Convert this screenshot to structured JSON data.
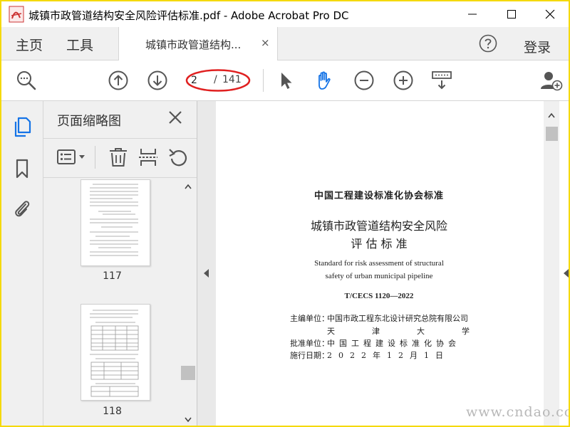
{
  "window": {
    "title": "城镇市政管道结构安全风险评估标准.pdf - Adobe Acrobat Pro DC"
  },
  "menu": {
    "home": "主页",
    "tools": "工具",
    "login": "登录"
  },
  "tab": {
    "label": "城镇市政管道结构...",
    "close": "×"
  },
  "toolbar": {
    "page_current": "2",
    "page_separator": "/",
    "page_total": "141"
  },
  "panel": {
    "title": "页面缩略图",
    "thumbnails": [
      {
        "label": "117"
      },
      {
        "label": "118"
      }
    ]
  },
  "document": {
    "org_header": "中国工程建设标准化协会标准",
    "title_line1": "城镇市政管道结构安全风险",
    "title_line2": "评 估 标 准",
    "en_line1": "Standard for risk assessment of structural",
    "en_line2": "safety of urban municipal pipeline",
    "code": "T/CECS 1120—2022",
    "rows": [
      {
        "label": "主编单位：",
        "value": "中国市政工程东北设计研究总院有限公司"
      },
      {
        "label": "",
        "value": "天津大学"
      },
      {
        "label": "批准单位：",
        "value": "中国工程建设标准化协会"
      },
      {
        "label": "施行日期：",
        "value": "2022年12月1日"
      }
    ]
  },
  "watermark": "www.cndao.com",
  "colors": {
    "accent_blue": "#1473e6",
    "frame_yellow": "#f5d90a",
    "annotation_red": "#e02020"
  }
}
